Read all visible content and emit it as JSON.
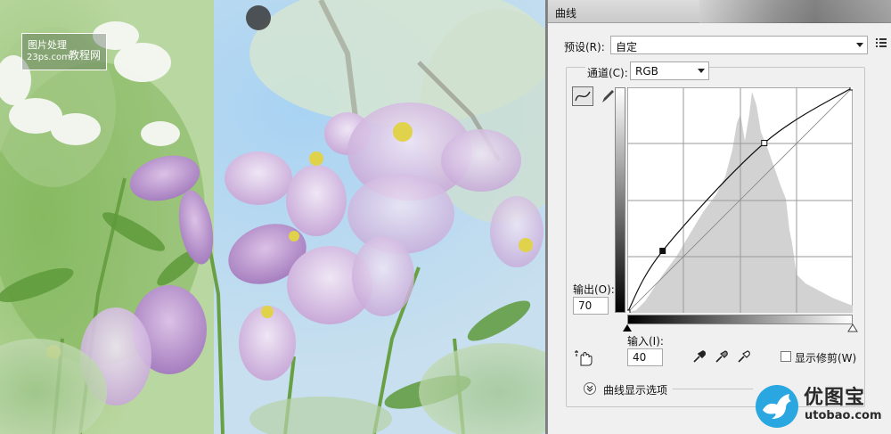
{
  "photo": {
    "watermark_line1": "图片处理",
    "watermark_line2": "23ps.com",
    "watermark_line3": "教程网"
  },
  "dialog": {
    "title": "曲线",
    "preset_label": "预设(R):",
    "preset_value": "自定",
    "channel_label": "通道(C):",
    "channel_value": "RGB",
    "output_label": "输出(O):",
    "output_value": "70",
    "input_label": "输入(I):",
    "input_value": "40",
    "show_clipping_label": "显示修剪(W)",
    "curve_display_options_label": "曲线显示选项"
  },
  "curve": {
    "points": [
      [
        0,
        0
      ],
      [
        40,
        70
      ],
      [
        155,
        192
      ],
      [
        255,
        255
      ]
    ],
    "selected_point": [
      40,
      70
    ]
  },
  "logo": {
    "name": "优图宝",
    "url": "utobao.com"
  },
  "colors": {
    "dialog_bg": "#f0f0f0",
    "histogram": "#d2d2d2",
    "accent_logo": "#2aa6e0"
  },
  "icons": [
    "curve-tool-icon",
    "pencil-icon",
    "eyedropper-black-icon",
    "eyedropper-gray-icon",
    "eyedropper-white-icon",
    "target-adjust-hand-icon",
    "list-menu-icon",
    "expand-icon",
    "bird-logo-icon"
  ]
}
